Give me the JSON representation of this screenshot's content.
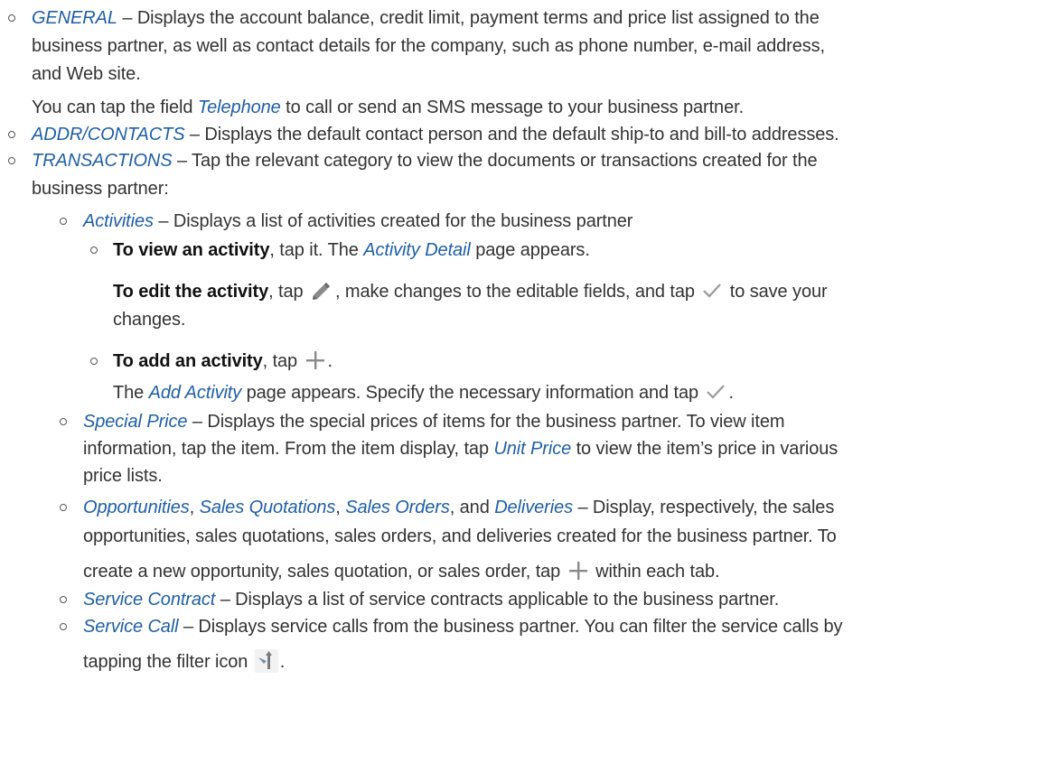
{
  "items": {
    "general": {
      "term": "GENERAL",
      "line1": " – Displays the account balance, credit limit, payment terms and price list assigned to the",
      "line2": "business partner, as well as contact details for the company, such as phone number, e-mail address,",
      "line3": "and Web site.",
      "note_pre": "You can tap the field ",
      "note_term": "Telephone",
      "note_post": " to call or send an SMS message to your business partner."
    },
    "addr": {
      "term": "ADDR/CONTACTS",
      "text": " – Displays the default contact person and the default ship-to and bill-to addresses."
    },
    "transactions": {
      "term": "TRANSACTIONS",
      "line1": " – Tap the relevant category to view the documents or transactions created for the",
      "line2": "business partner:"
    },
    "activities": {
      "term": "Activities",
      "text": " – Displays a list of activities created for the business partner",
      "view_strong": "To view an activity",
      "view_mid": ", tap it. The ",
      "view_term": "Activity Detail",
      "view_post": " page appears.",
      "edit_strong": "To edit the activity",
      "edit_pre": ", tap ",
      "edit_mid": ", make changes to the editable fields, and tap ",
      "edit_post": " to save your",
      "edit_line2": "changes.",
      "add_strong": "To add an activity",
      "add_pre": ", tap ",
      "add_post": ".",
      "add2_pre": "The ",
      "add2_term": "Add Activity",
      "add2_mid": " page appears. Specify the necessary information and tap ",
      "add2_post": "."
    },
    "special_price": {
      "term": "Special Price",
      "line1": " – Displays the special prices of items for the business partner. To view item",
      "line2_pre": "information, tap the item. From the item display, tap ",
      "line2_term": "Unit Price",
      "line2_post": " to view the item’s price in various",
      "line3": "price lists."
    },
    "opportunities": {
      "term1": "Opportunities",
      "sep1": ", ",
      "term2": "Sales Quotations",
      "sep2": ", ",
      "term3": "Sales Orders",
      "sep3": ", and ",
      "term4": "Deliveries",
      "line1_post": " – Display, respectively, the sales",
      "line2": "opportunities, sales quotations, sales orders, and deliveries created for the business partner. To",
      "line3_pre": "create a new opportunity, sales quotation, or sales order, tap ",
      "line3_post": " within each tab."
    },
    "service_contract": {
      "term": "Service Contract",
      "text": " – Displays a list of service contracts applicable to the business partner."
    },
    "service_call": {
      "term": "Service Call",
      "line1": " – Displays service calls from the business partner. You can filter the service calls by",
      "line2_pre": "tapping the filter icon ",
      "line2_post": "."
    }
  },
  "icons": {
    "edit": "pencil-icon",
    "save": "checkmark-icon",
    "add": "plus-icon",
    "filter": "filter-icon"
  },
  "colors": {
    "ui_term": "#1f5fa8",
    "body_text": "#333333"
  }
}
